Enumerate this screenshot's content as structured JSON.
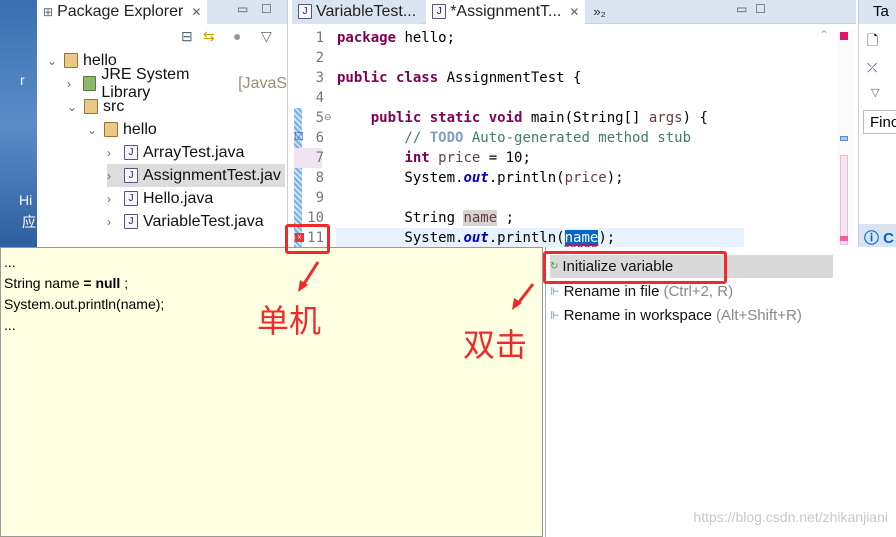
{
  "desktop": {
    "fragments": [
      "r",
      "Hi",
      "应"
    ]
  },
  "package_explorer": {
    "title": "Package Explorer",
    "tree": [
      {
        "label": "hello",
        "depth": 0,
        "expanded": true,
        "icon": "project-icon"
      },
      {
        "label": "JRE System Library",
        "suffix": "[JavaS",
        "depth": 1,
        "expanded": false,
        "icon": "library-icon"
      },
      {
        "label": "src",
        "depth": 1,
        "expanded": true,
        "icon": "source-folder-icon"
      },
      {
        "label": "hello",
        "depth": 2,
        "expanded": true,
        "icon": "package-icon"
      },
      {
        "label": "ArrayTest.java",
        "depth": 3,
        "expanded": false,
        "icon": "java-file-icon"
      },
      {
        "label": "AssignmentTest.jav",
        "depth": 3,
        "expanded": false,
        "icon": "java-file-icon",
        "selected": true
      },
      {
        "label": "Hello.java",
        "depth": 3,
        "expanded": false,
        "icon": "java-file-warning-icon"
      },
      {
        "label": "VariableTest.java",
        "depth": 3,
        "expanded": false,
        "icon": "java-file-warning-icon"
      }
    ]
  },
  "editor": {
    "tabs": [
      {
        "label": "VariableTest..."
      },
      {
        "label": "*AssignmentT...",
        "active": true
      }
    ],
    "overflow": "»₂",
    "line_numbers": [
      "1",
      "2",
      "3",
      "4",
      "5",
      "6",
      "7",
      "8",
      "9",
      "10",
      "11"
    ]
  },
  "right_panel": {
    "tab": "Ta",
    "find": "Finc",
    "info": "C"
  },
  "quickfix": {
    "preview": [
      "...",
      "String name ",
      "= null",
      " ;",
      "System.out.println(name);",
      "..."
    ],
    "proposals": [
      {
        "label": "Initialize variable",
        "shortcut": "",
        "selected": true
      },
      {
        "label": "Rename in file",
        "shortcut": "(Ctrl+2, R)"
      },
      {
        "label": "Rename in workspace",
        "shortcut": "(Alt+Shift+R)"
      }
    ]
  },
  "annotations": {
    "single_click": "单机",
    "double_click": "双击",
    "color": "#f02a2a"
  },
  "watermark": "https://blog.csdn.net/zhikanjiani"
}
